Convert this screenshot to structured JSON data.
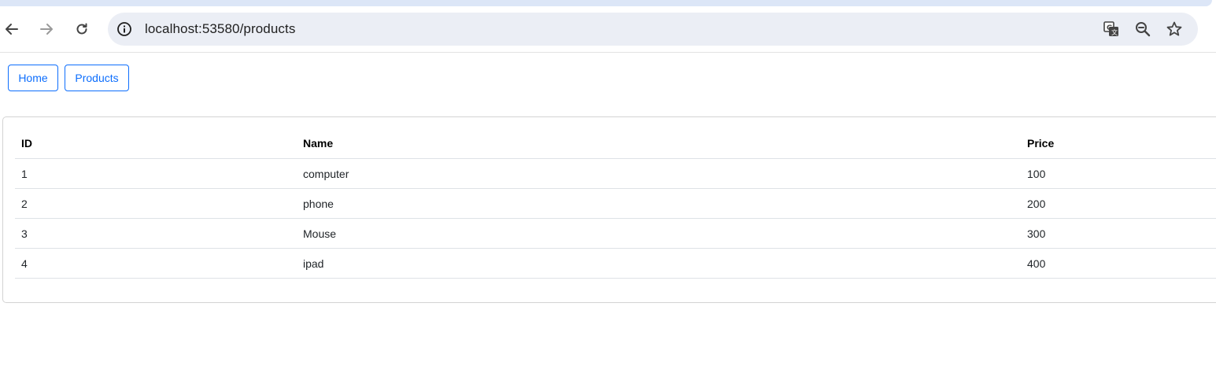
{
  "browser": {
    "url": "localhost:53580/products",
    "icons": {
      "back": "back-arrow-icon",
      "forward": "forward-arrow-icon",
      "reload": "reload-icon",
      "site_info": "site-info-icon",
      "translate": "translate-icon",
      "zoom": "zoom-out-icon",
      "bookmark": "bookmark-star-icon"
    }
  },
  "nav": {
    "home_label": "Home",
    "products_label": "Products"
  },
  "table": {
    "headers": [
      "ID",
      "Name",
      "Price"
    ],
    "rows": [
      [
        "1",
        "computer",
        "100"
      ],
      [
        "2",
        "phone",
        "200"
      ],
      [
        "3",
        "Mouse",
        "300"
      ],
      [
        "4",
        "ipad",
        "400"
      ]
    ]
  },
  "colors": {
    "accent": "#0d6efd",
    "omnibox_bg": "#ebeef5",
    "tabstrip": "#dce6f7"
  }
}
